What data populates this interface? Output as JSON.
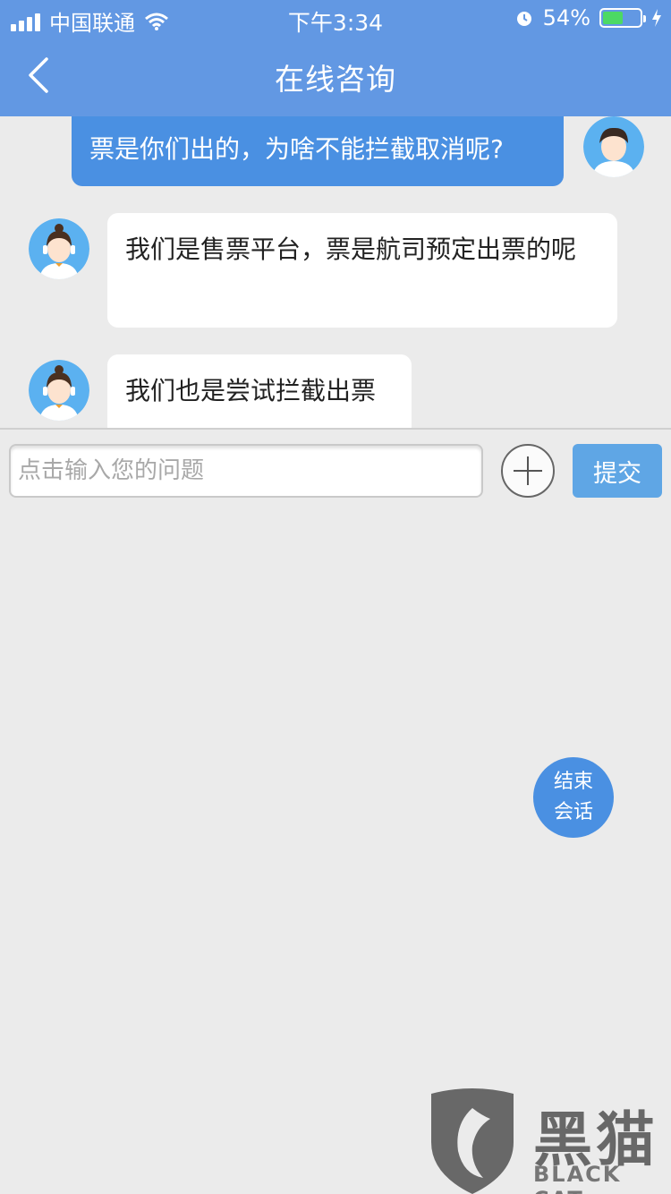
{
  "status": {
    "carrier": "中国联通",
    "time": "下午3:34",
    "battery_percent": "54%",
    "battery_level": 0.54,
    "icons": [
      "signal-icon",
      "wifi-icon",
      "alarm-icon",
      "battery-icon",
      "charging-icon"
    ]
  },
  "nav": {
    "title": "在线咨询",
    "back_icon": "chevron-left-icon"
  },
  "messages": [
    {
      "sender": "user",
      "text": "票是你们出的，为啥不能拦截取消呢?"
    },
    {
      "sender": "agent",
      "text": "我们是售票平台，票是航司预定出票的呢"
    },
    {
      "sender": "agent",
      "text": "我们也是尝试拦截出票"
    }
  ],
  "input": {
    "placeholder": "点击输入您的问题",
    "value": ""
  },
  "actions": {
    "submit_label": "提交",
    "end_line1": "结束",
    "end_line2": "会话"
  },
  "watermark": {
    "cn": "黑猫",
    "en": "BLACK CAT"
  },
  "colors": {
    "header": "#6298e3",
    "user_bubble": "#4a90e2",
    "submit": "#5fa6e5",
    "background": "#ebebeb"
  }
}
